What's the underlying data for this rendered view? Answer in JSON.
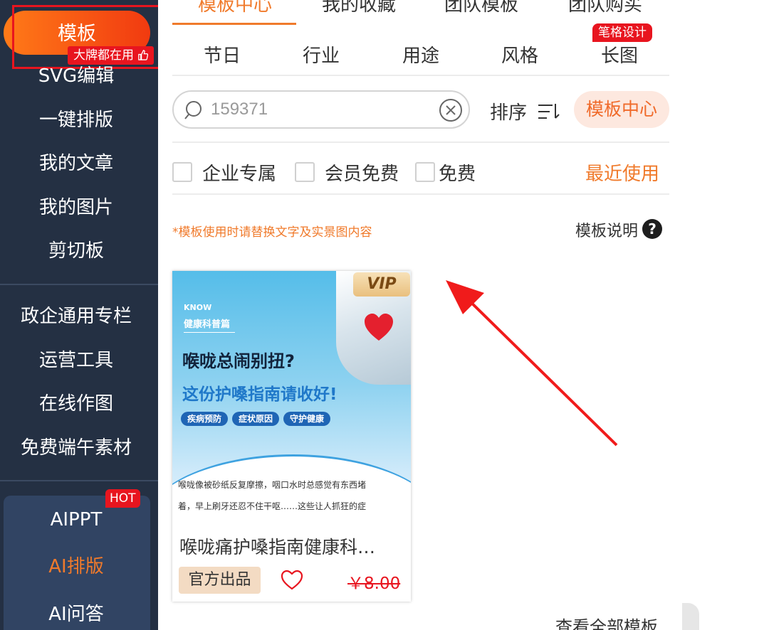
{
  "sidebar": {
    "active_label": "模板",
    "active_badge": "大牌都在用",
    "items": [
      "SVG编辑",
      "一键排版",
      "我的文章",
      "我的图片",
      "剪切板"
    ],
    "section2": [
      "政企通用专栏",
      "运营工具",
      "在线作图",
      "免费端午素材"
    ],
    "ai": {
      "hot": "HOT",
      "items": [
        "AIPPT",
        "AI排版",
        "AI问答"
      ],
      "highlight_color": "#f07a2b"
    }
  },
  "top_tabs": [
    "模板中心",
    "我的收藏",
    "团队模板",
    "团队购买"
  ],
  "categories": [
    "节日",
    "行业",
    "用途",
    "风格",
    "长图"
  ],
  "category_badge": "笔格设计",
  "search": {
    "value": "159371"
  },
  "sort_label": "排序",
  "center_button": "模板中心",
  "filters": [
    "企业专属",
    "会员免费",
    "免费"
  ],
  "recent": "最近使用",
  "notice": "*模板使用时请替换文字及实景图内容",
  "explain": "模板说明",
  "explain_icon": "?",
  "card": {
    "vip": "VIP",
    "know": "KNOW",
    "kp": "健康科普篇",
    "headline1": "喉咙总闹别扭?",
    "headline2": "这份护嗓指南请收好!",
    "tags": [
      "疾病预防",
      "症状原因",
      "守护健康"
    ],
    "body1": "喉咙像被砂纸反复摩擦，咽口水时总感觉有东西堵",
    "body2": "着，早上刷牙还忍不住干呕……这些让人抓狂的症",
    "title": "喉咙痛护嗓指南健康科…",
    "official": "官方出品",
    "price": "￥8.00"
  },
  "more": "查看全部模板",
  "colors": {
    "accent": "#f07a2b",
    "sidebar": "#243043",
    "red": "#e8151f"
  }
}
